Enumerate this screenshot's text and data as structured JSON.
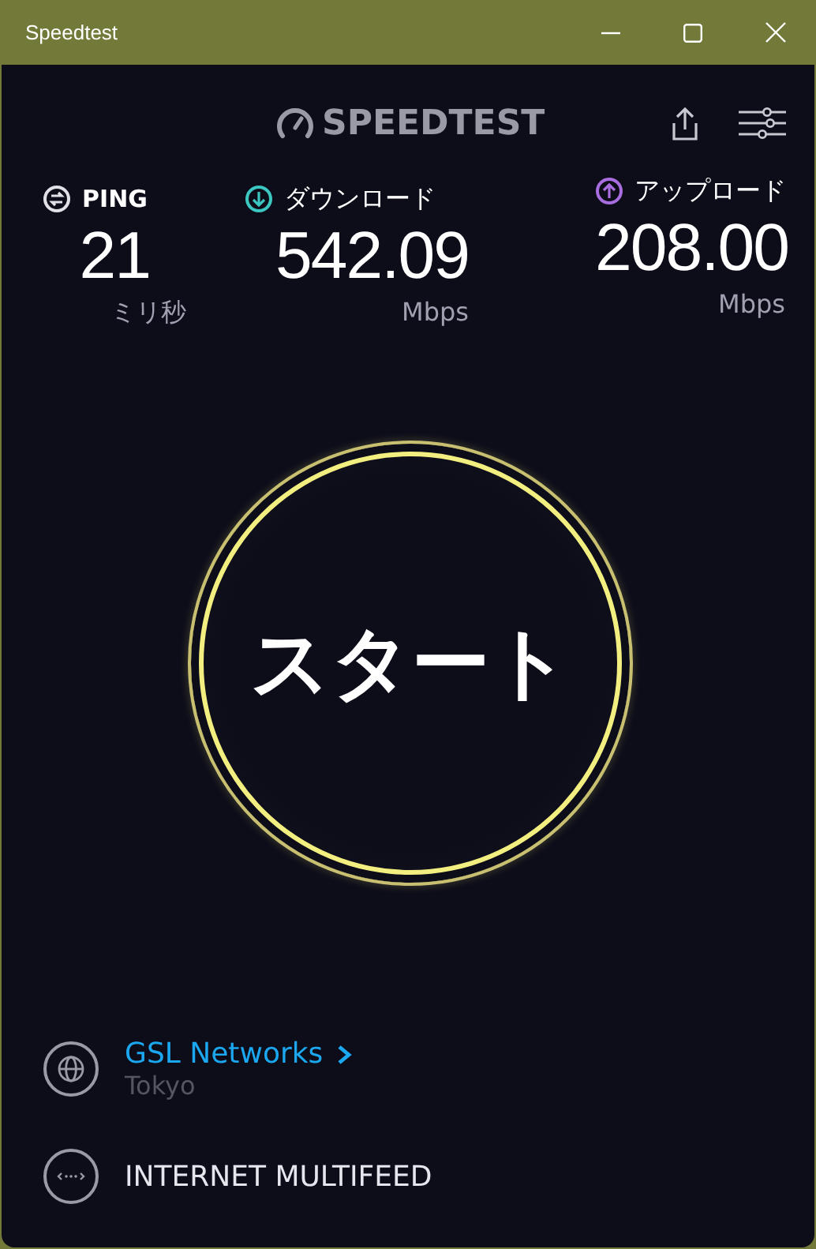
{
  "window": {
    "title": "Speedtest",
    "controls": [
      {
        "kind": "minimize"
      },
      {
        "kind": "maximize"
      },
      {
        "kind": "close"
      }
    ]
  },
  "header": {
    "logo": "SPEEDTEST",
    "actions": [
      {
        "kind": "share"
      },
      {
        "kind": "settings"
      }
    ]
  },
  "metrics": [
    {
      "kind": "ping",
      "label": "PING",
      "value": "21",
      "unit": "ミリ秒",
      "color": "#e0e0e6"
    },
    {
      "kind": "download",
      "label": "ダウンロード",
      "value": "542.09",
      "unit": "Mbps",
      "color": "#3cc6c0"
    },
    {
      "kind": "upload",
      "label": "アップロード",
      "value": "208.00",
      "unit": "Mbps",
      "color": "#a86ee0"
    }
  ],
  "start_button": {
    "label": "スタート"
  },
  "servers": [
    {
      "kind": "host",
      "name": "GSL Networks",
      "location": "Tokyo"
    },
    {
      "kind": "provider",
      "name": "INTERNET MULTIFEED"
    }
  ]
}
